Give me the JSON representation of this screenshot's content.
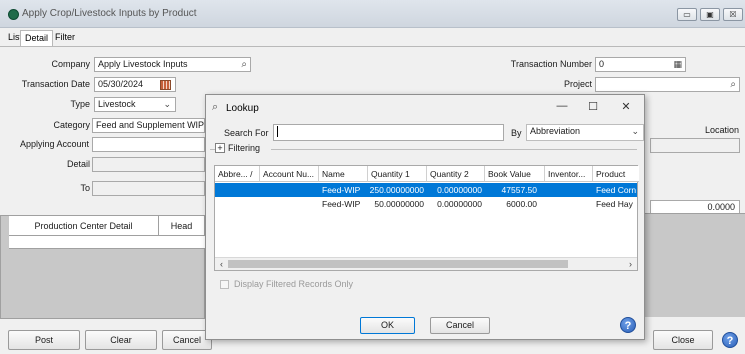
{
  "window": {
    "title": "Apply Crop/Livestock Inputs by Product",
    "minimize": "▭",
    "maximize": "▣",
    "close": "☒"
  },
  "tabs": [
    "List",
    "Detail",
    "Filter"
  ],
  "form": {
    "company_label": "Company",
    "company_value": "Apply Livestock Inputs",
    "transaction_date_label": "Transaction Date",
    "transaction_date_value": "05/30/2024",
    "type_label": "Type",
    "type_value": "Livestock",
    "category_label": "Category",
    "category_value": "Feed and Supplement WIP",
    "applying_account_label": "Applying Account",
    "detail_label": "Detail",
    "to_label": "To",
    "transaction_number_label": "Transaction Number",
    "transaction_number_value": "0",
    "project_label": "Project",
    "location_label": "Location",
    "amount_value": "0.0000"
  },
  "grid": {
    "columns": [
      "Production Center Detail",
      "Head"
    ]
  },
  "bottom_buttons": {
    "post": "Post",
    "clear": "Clear",
    "cancel": "Cancel",
    "close": "Close"
  },
  "lookup": {
    "title": "Lookup",
    "minimize": "—",
    "maximize": "☐",
    "close": "✕",
    "search_for_label": "Search For",
    "search_value": "",
    "by_label": "By",
    "by_value": "Abbreviation",
    "filtering_toggle": "+",
    "filtering_label": "Filtering",
    "columns": [
      "Abbre...",
      "/",
      "Account Nu...",
      "Name",
      "Quantity 1",
      "Quantity 2",
      "Book Value",
      "Inventor...",
      "Product"
    ],
    "rows": [
      {
        "abbreviation": "",
        "account_number": "",
        "name": "Feed-WIP",
        "quantity1": "250.00000000",
        "quantity2": "0.00000000",
        "book_value": "47557.50",
        "inventory": "",
        "product": "Feed Corn",
        "selected": true
      },
      {
        "abbreviation": "",
        "account_number": "",
        "name": "Feed-WIP",
        "quantity1": "50.00000000",
        "quantity2": "0.00000000",
        "book_value": "6000.00",
        "inventory": "",
        "product": "Feed Hay",
        "selected": false
      }
    ],
    "display_filtered_label": "Display Filtered Records Only",
    "ok": "OK",
    "cancel": "Cancel"
  },
  "colors": {
    "selection": "#0078d7",
    "accent": "#2a5fb8"
  }
}
